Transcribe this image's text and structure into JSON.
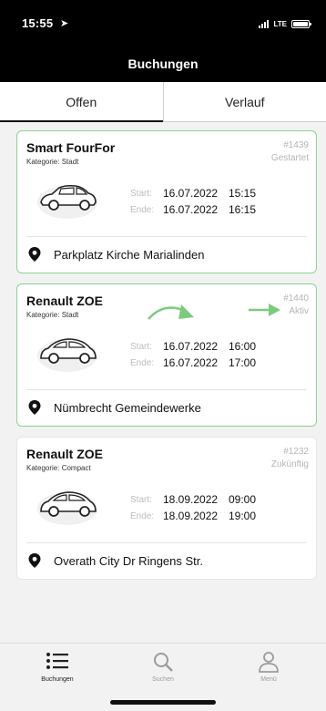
{
  "status": {
    "time": "15:55",
    "network": "LTE"
  },
  "header": {
    "title": "Buchungen"
  },
  "tabs": [
    {
      "label": "Offen",
      "active": true
    },
    {
      "label": "Verlauf",
      "active": false
    }
  ],
  "bookings": [
    {
      "name": "Smart FourFor",
      "category": "Kategorie: Stadt",
      "id": "#1439",
      "state": "Gestartet",
      "start_label": "Start:",
      "start_date": "16.07.2022",
      "start_time": "15:15",
      "end_label": "Ende:",
      "end_date": "16.07.2022",
      "end_time": "16:15",
      "location": "Parkplatz Kirche Marialinden"
    },
    {
      "name": "Renault ZOE",
      "category": "Kategorie: Stadt",
      "id": "#1440",
      "state": "Aktiv",
      "start_label": "Start:",
      "start_date": "16.07.2022",
      "start_time": "16:00",
      "end_label": "Ende:",
      "end_date": "16.07.2022",
      "end_time": "17:00",
      "location": "Nümbrecht Gemeindewerke"
    },
    {
      "name": "Renault ZOE",
      "category": "Kategorie: Compact",
      "id": "#1232",
      "state": "Zukünftig",
      "start_label": "Start:",
      "start_date": "18.09.2022",
      "start_time": "09:00",
      "end_label": "Ende:",
      "end_date": "18.09.2022",
      "end_time": "19:00",
      "location": "Overath City Dr Ringens Str."
    }
  ],
  "bottom_nav": [
    {
      "label": "Buchungen",
      "icon": "list-icon",
      "active": true
    },
    {
      "label": "Suchen",
      "icon": "search-icon",
      "active": false
    },
    {
      "label": "Menü",
      "icon": "user-icon",
      "active": false
    }
  ],
  "colors": {
    "accent_green": "#7ccb7d",
    "header_bg": "#000000"
  }
}
